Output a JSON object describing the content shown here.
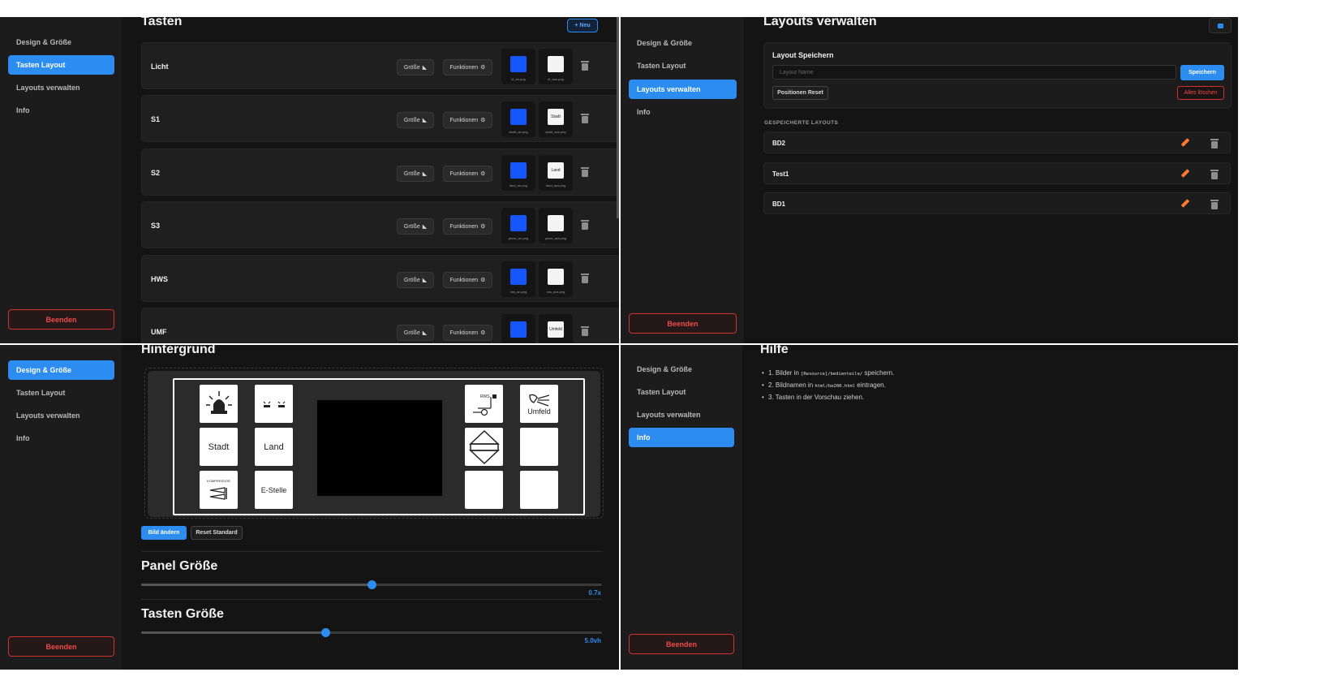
{
  "nav": {
    "design": "Design & Größe",
    "keys_layout": "Tasten Layout",
    "manage_layouts": "Layouts verwalten",
    "info": "Info",
    "quit": "Beenden"
  },
  "keys_panel": {
    "title": "Tasten",
    "new_button": "+ Neu",
    "size_label": "Größe",
    "functions_label": "Funktionen",
    "rows": [
      {
        "name": "Licht",
        "img_on": "bl_an.png",
        "img_off": "bl_aus.png",
        "off_text": ""
      },
      {
        "name": "S1",
        "img_on": "stadt_an.png",
        "img_off": "stadt_aus.png",
        "off_text": "Stadt"
      },
      {
        "name": "S2",
        "img_on": "land_an.png",
        "img_off": "land_aus.png",
        "off_text": "Land"
      },
      {
        "name": "S3",
        "img_on": "presc_an.png",
        "img_off": "presc_aus.png",
        "off_text": ""
      },
      {
        "name": "HWS",
        "img_on": "rws_an.png",
        "img_off": "rws_aus.png",
        "off_text": ""
      },
      {
        "name": "UMF",
        "img_on": "",
        "img_off": "",
        "off_text": "Umfeld"
      }
    ]
  },
  "layouts_panel": {
    "title": "Layouts verwalten",
    "save_card_title": "Layout Speichern",
    "name_placeholder": "Layout Name",
    "save_button": "Speichern",
    "reset_positions_button": "Positionen Reset",
    "delete_all_button": "Alles löschen",
    "saved_heading": "GESPEICHERTE LAYOUTS",
    "saved": [
      "BD2",
      "Test1",
      "BD1"
    ]
  },
  "background_panel": {
    "title": "Hintergrund",
    "change_image_button": "Bild ändern",
    "reset_default_button": "Reset Standard",
    "panel_size_title": "Panel Größe",
    "panel_size_value": "0.7x",
    "panel_size_fraction": 0.5,
    "key_size_title": "Tasten Größe",
    "key_size_value": "5.0vh",
    "key_size_fraction": 0.4,
    "keys": {
      "stadt": "Stadt",
      "land": "Land",
      "estelle": "E-Stelle",
      "kompressor": "KOMPRESSOR",
      "umfeld": "Umfeld",
      "rws": "RWS"
    }
  },
  "help_panel": {
    "title": "Hilfe",
    "step1_prefix": "1. Bilder in ",
    "step1_code": "[Resource]/bedienteile/",
    "step1_suffix": " speichern.",
    "step2_prefix": "2. Bildnamen in ",
    "step2_code": "html/be200.html",
    "step2_suffix": " eintragen.",
    "step3": "3. Tasten in der Vorschau ziehen."
  },
  "colors": {
    "accent": "#2d8cf0",
    "danger": "#ef4b48",
    "edit": "#ff7a2e",
    "bg": "#141414",
    "sidebar": "#1c1c1c"
  }
}
